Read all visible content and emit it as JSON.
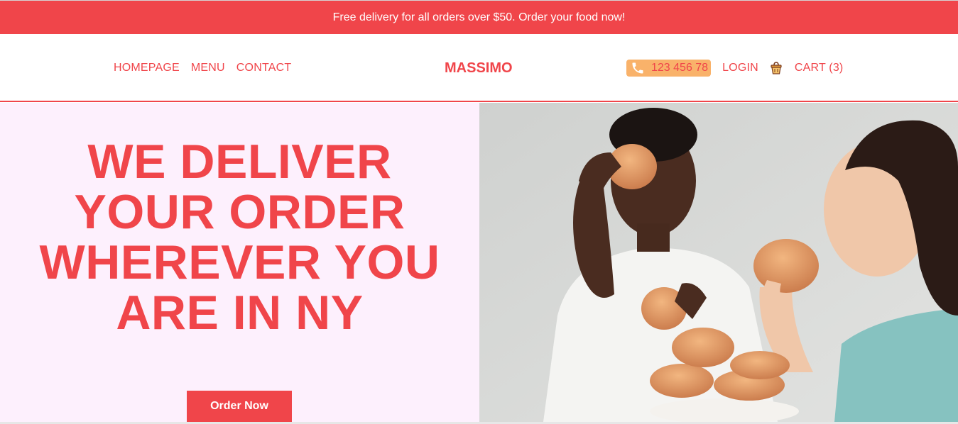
{
  "promo": {
    "text": "Free delivery for all orders over $50. Order your food now!"
  },
  "nav": {
    "links": [
      "HOMEPAGE",
      "MENU",
      "CONTACT"
    ],
    "logo": "MASSIMO",
    "phone": "123 456 78",
    "login": "LOGIN",
    "cart": "CART (3)"
  },
  "hero": {
    "title_lines": [
      "WE DELIVER",
      "YOUR ORDER",
      "WHEREVER YOU",
      "ARE IN NY"
    ],
    "cta": "Order Now"
  },
  "colors": {
    "accent": "#f0454a",
    "hero_bg": "#fdf0fd",
    "phone_bg": "#f9b26a"
  },
  "icons": {
    "phone": "phone-icon",
    "cart": "cart-basket-icon"
  }
}
